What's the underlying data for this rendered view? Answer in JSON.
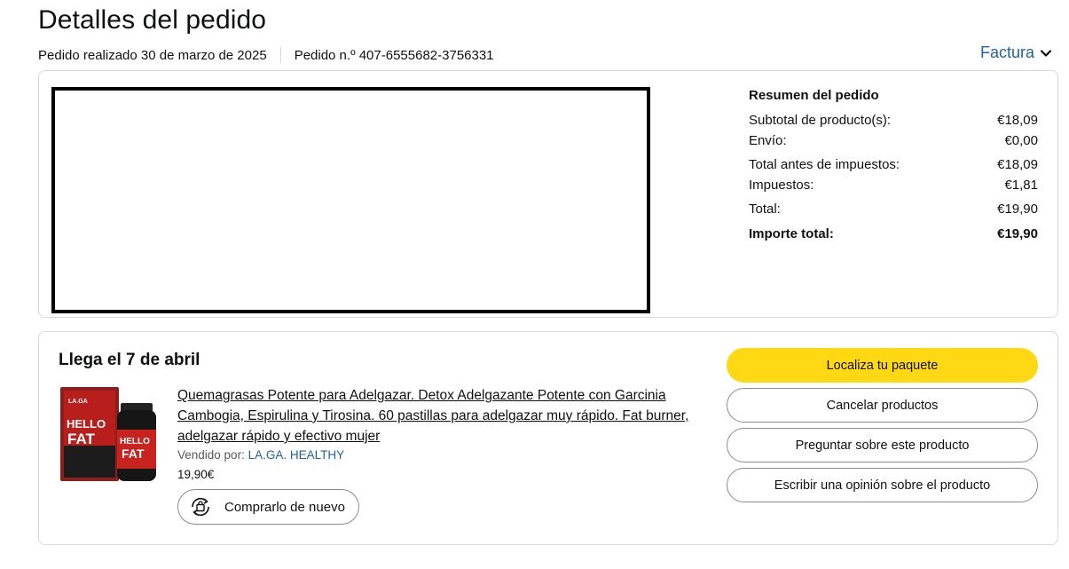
{
  "page": {
    "title": "Detalles del pedido",
    "order_placed": "Pedido realizado 30 de marzo de 2025",
    "order_number": "Pedido n.º 407-6555682-3756331",
    "invoice_label": "Factura"
  },
  "summary": {
    "title": "Resumen del pedido",
    "rows": [
      {
        "label": "Subtotal de producto(s):",
        "value": "€18,09"
      },
      {
        "label": "Envío:",
        "value": "€0,00"
      },
      {
        "label": "Total antes de impuestos:",
        "value": "€18,09"
      },
      {
        "label": "Impuestos:",
        "value": "€1,81"
      },
      {
        "label": "Total:",
        "value": "€19,90"
      },
      {
        "label": "Importe total:",
        "value": "€19,90"
      }
    ]
  },
  "delivery": {
    "arrival": "Llega el 7 de abril",
    "product": {
      "title": "Quemagrasas Potente para Adelgazar. Detox Adelgazante Potente con Garcinia Cambogia, Espirulina y Tirosina. 60 pastillas para adelgazar muy rápido. Fat burner, adelgazar rápido y efectivo mujer",
      "sold_by_label": "Vendido por:",
      "seller": "LA.GA. HEALTHY",
      "price": "19,90€",
      "image_text": {
        "brand": "LA.GA",
        "line1": "HELLO",
        "line2": "FAT"
      }
    },
    "buy_again_label": "Comprarlo de nuevo",
    "actions": {
      "track": "Localiza tu paquete",
      "cancel": "Cancelar productos",
      "ask": "Preguntar sobre este producto",
      "review": "Escribir una opinión sobre el producto"
    }
  },
  "colors": {
    "link": "#2162a1",
    "primary_button": "#ffd814",
    "border": "#d5d9d9"
  }
}
